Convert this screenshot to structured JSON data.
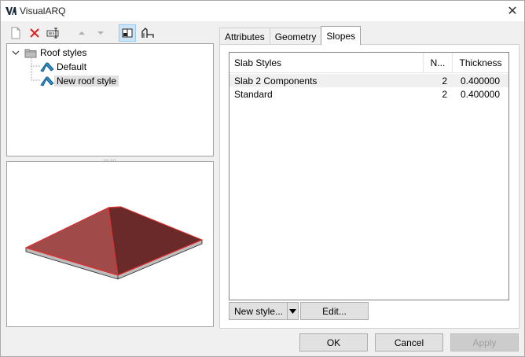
{
  "window": {
    "title": "VisualARQ",
    "close_glyph": "✕"
  },
  "toolbar": {
    "icons": [
      "new-icon",
      "delete-icon",
      "rename-icon",
      "move-up-icon",
      "move-down-icon",
      "split-view-icon",
      "profile-icon"
    ]
  },
  "tree": {
    "root_label": "Roof styles",
    "items": [
      {
        "label": "Default"
      },
      {
        "label": "New roof style",
        "selected": true
      }
    ]
  },
  "splitter": "⋯⋯",
  "tabs": [
    {
      "label": "Attributes"
    },
    {
      "label": "Geometry"
    },
    {
      "label": "Slopes",
      "active": true
    }
  ],
  "grid": {
    "columns": [
      "Slab Styles",
      "N...",
      "Thickness"
    ],
    "rows": [
      {
        "name": "Slab 2 Components",
        "n": "2",
        "thickness": "0.400000",
        "selected": true
      },
      {
        "name": "Standard",
        "n": "2",
        "thickness": "0.400000"
      }
    ]
  },
  "buttons": {
    "new_style": "New style...",
    "edit": "Edit...",
    "ok": "OK",
    "cancel": "Cancel",
    "apply": "Apply"
  },
  "colors": {
    "roof": "#8b3a3a",
    "roof_edge": "#e03030",
    "slab": "#bdbdbd",
    "selection": "#cce4f7"
  }
}
